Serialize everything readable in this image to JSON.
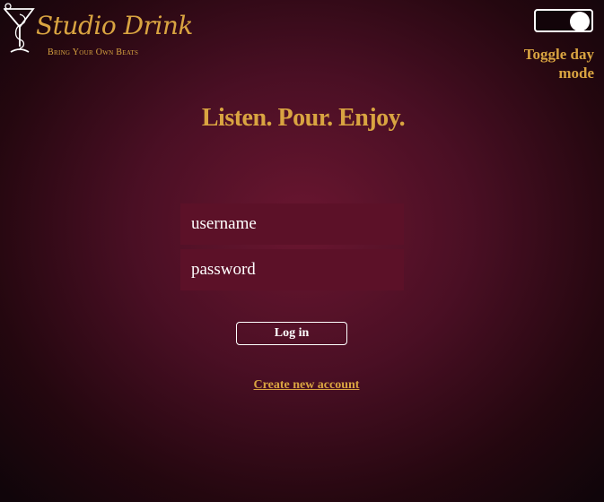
{
  "brand": {
    "title": "Studio Drink",
    "tagline": "Bring Your Own Beats",
    "icon": "cocktail-glass-treble-clef-icon"
  },
  "theme_toggle": {
    "label": "Toggle day mode",
    "state": "on"
  },
  "headline": "Listen. Pour. Enjoy.",
  "login_form": {
    "username_placeholder": "username",
    "password_placeholder": "password",
    "submit_label": "Log in"
  },
  "create_account_link": "Create new account",
  "colors": {
    "accent": "#d9a441",
    "background": "#4a0f24",
    "field": "#5c1128",
    "text": "#ffffff"
  }
}
